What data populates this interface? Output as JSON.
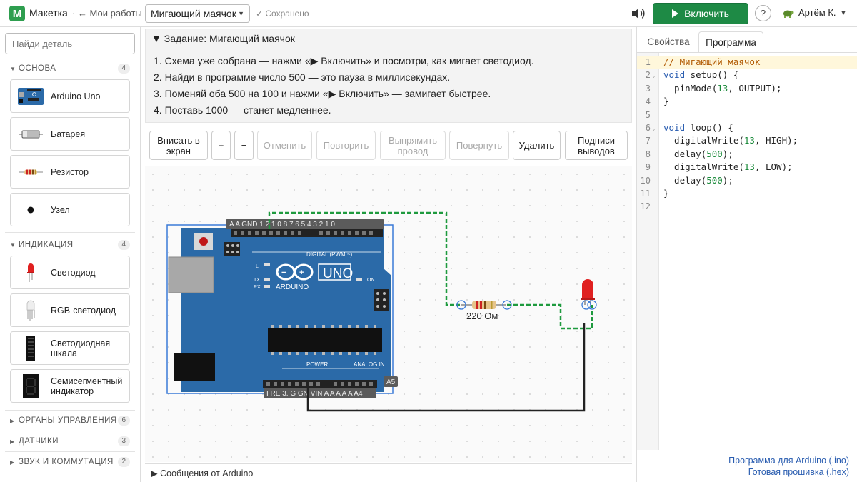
{
  "topbar": {
    "app_title": "Макетка",
    "back_link": "· ← Мои работы",
    "project_name": "Мигающий маячок",
    "saved_status": "✓ Сохранено",
    "run_label": "Включить",
    "help_label": "?",
    "user_name": "Артём К."
  },
  "sidebar": {
    "search_placeholder": "Найди деталь",
    "categories": [
      {
        "label": "ОСНОВА",
        "count": "4",
        "expanded": true,
        "parts": [
          "Arduino Uno",
          "Батарея",
          "Резистор",
          "Узел"
        ]
      },
      {
        "label": "ИНДИКАЦИЯ",
        "count": "4",
        "expanded": true,
        "parts": [
          "Светодиод",
          "RGB-светодиод",
          "Светодиодная шкала",
          "Семисегментный индикатор"
        ]
      },
      {
        "label": "ОРГАНЫ УПРАВЛЕНИЯ",
        "count": "6",
        "expanded": false
      },
      {
        "label": "ДАТЧИКИ",
        "count": "3",
        "expanded": false
      },
      {
        "label": "ЗВУК И КОММУТАЦИЯ",
        "count": "2",
        "expanded": false
      }
    ]
  },
  "task": {
    "title": "▼ Задание: Мигающий маячок",
    "steps": [
      "1. Схема уже собрана — нажми «▶ Включить» и посмотри, как мигает светодиод.",
      "2. Найди в программе число 500 — это пауза в миллисекундах.",
      "3. Поменяй оба 500 на 100 и нажми «▶ Включить» — замигает быстрее.",
      "4. Поставь 1000 — станет медленнее."
    ]
  },
  "toolbar": {
    "fit": "Вписать в экран",
    "zoom_in": "+",
    "zoom_out": "−",
    "undo": "Отменить",
    "redo": "Повторить",
    "straighten": "Выпрямить провод",
    "rotate": "Повернуть",
    "delete": "Удалить",
    "pin_labels": "Подписи выводов"
  },
  "canvas": {
    "board_logo": "UNO",
    "board_brand": "ARDUINO",
    "digital_label": "DIGITAL (PWM ~)",
    "power_label": "POWER",
    "analog_label": "ANALOG IN",
    "header_top": "A A GND 1 2 1 0 8  7 6 5 4 3 2 1 0",
    "header_bottom": "I RE 3. G GN VIN A A A A A A4",
    "pin_a5": "A5",
    "resistor_label": "220 Ом",
    "wire_colors": {
      "signal": "#1e9a3e",
      "ground": "#222222"
    }
  },
  "messages_label": "▶ Сообщения от Arduino",
  "right_panel": {
    "tabs": [
      "Свойства",
      "Программа"
    ],
    "active_tab": "Программа",
    "code_lines": [
      "// Мигающий маячок",
      "void setup() {",
      "  pinMode(13, OUTPUT);",
      "}",
      "",
      "void loop() {",
      "  digitalWrite(13, HIGH);",
      "  delay(500);",
      "  digitalWrite(13, LOW);",
      "  delay(500);",
      "}",
      ""
    ],
    "line_numbers": [
      "1",
      "2",
      "3",
      "4",
      "5",
      "6",
      "7",
      "8",
      "9",
      "10",
      "11",
      "12"
    ],
    "links": [
      "Программа для Arduino (.ino)",
      "Готовая прошивка (.hex)"
    ]
  },
  "colors": {
    "accent": "#1e8a45",
    "link": "#2a5db0",
    "board": "#2b6aa8",
    "led": "#e02020"
  }
}
